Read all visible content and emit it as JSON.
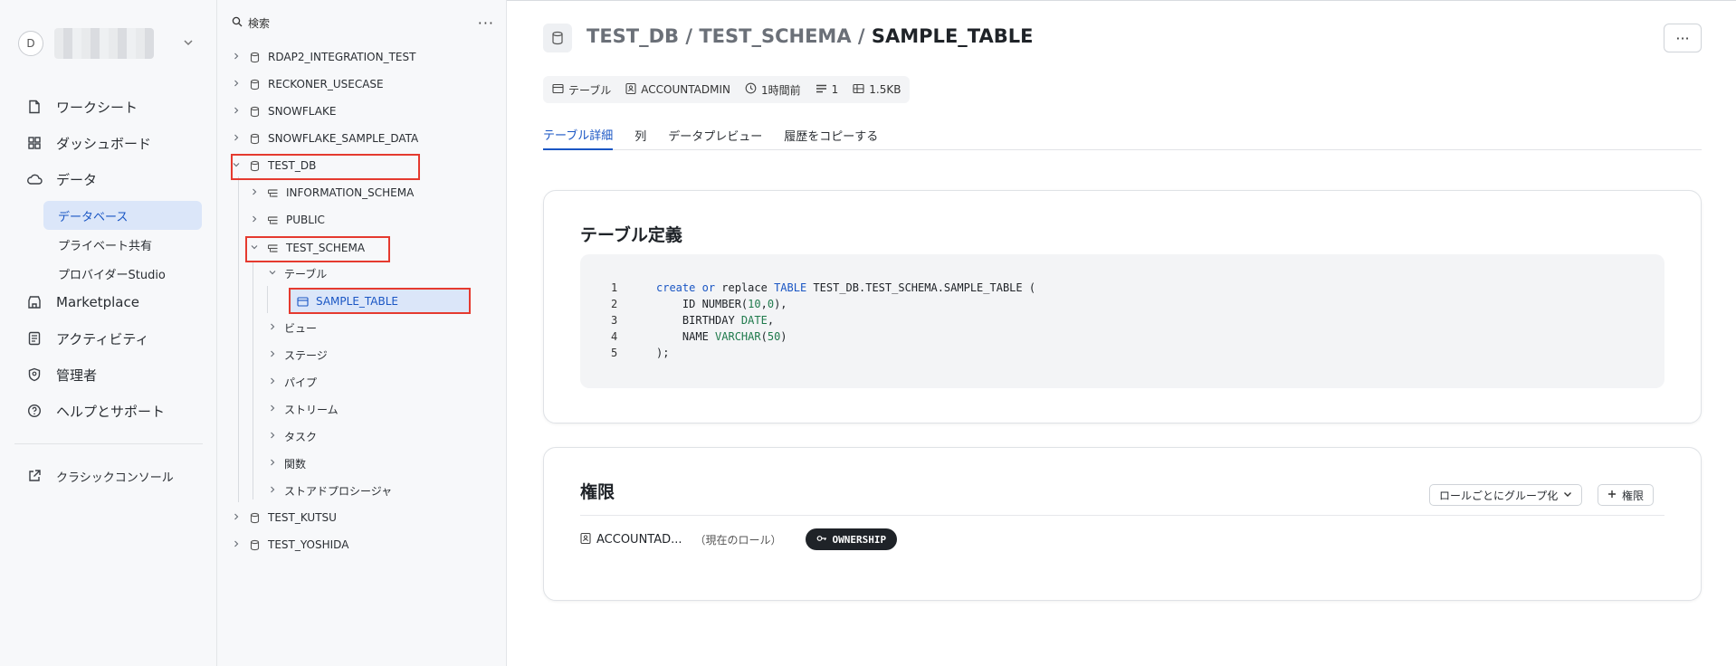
{
  "nav": {
    "avatar_initial": "D",
    "items": [
      {
        "label": "ワークシート",
        "icon": "file-icon"
      },
      {
        "label": "ダッシュボード",
        "icon": "grid-icon"
      },
      {
        "label": "データ",
        "icon": "cloud-icon"
      }
    ],
    "sub_items": [
      {
        "label": "データベース",
        "active": true
      },
      {
        "label": "プライベート共有",
        "active": false
      },
      {
        "label": "プロバイダーStudio",
        "active": false
      }
    ],
    "items2": [
      {
        "label": "Marketplace",
        "icon": "store-icon"
      },
      {
        "label": "アクティビティ",
        "icon": "activity-icon"
      },
      {
        "label": "管理者",
        "icon": "shield-icon"
      },
      {
        "label": "ヘルプとサポート",
        "icon": "help-icon"
      }
    ],
    "classic_console": "クラシックコンソール"
  },
  "tree": {
    "search_label": "検索",
    "more": "···",
    "nodes": [
      "RDAP2_INTEGRATION_TEST",
      "RECKONER_USECASE",
      "SNOWFLAKE",
      "SNOWFLAKE_SAMPLE_DATA",
      "TEST_DB",
      "INFORMATION_SCHEMA",
      "PUBLIC",
      "TEST_SCHEMA",
      "テーブル",
      "SAMPLE_TABLE",
      "ビュー",
      "ステージ",
      "パイプ",
      "ストリーム",
      "タスク",
      "関数",
      "ストアドプロシージャ",
      "TEST_KUTSU",
      "TEST_YOSHIDA"
    ]
  },
  "header": {
    "crumb_db": "TEST_DB",
    "crumb_schema": "TEST_SCHEMA",
    "sep": " / ",
    "crumb_table": "SAMPLE_TABLE",
    "more": "···"
  },
  "meta": {
    "type": "テーブル",
    "owner": "ACCOUNTADMIN",
    "time": "1時間前",
    "rows": "1",
    "size": "1.5KB"
  },
  "tabs": [
    "テーブル詳細",
    "列",
    "データプレビュー",
    "履歴をコピーする"
  ],
  "definition": {
    "title": "テーブル定義",
    "lines": [
      "1",
      "2",
      "3",
      "4",
      "5"
    ]
  },
  "permissions": {
    "title": "権限",
    "group_by": "ロールごとにグループ化",
    "add": "権限",
    "role": "ACCOUNTAD...",
    "note": "（現在のロール）",
    "privilege": "OWNERSHIP"
  }
}
